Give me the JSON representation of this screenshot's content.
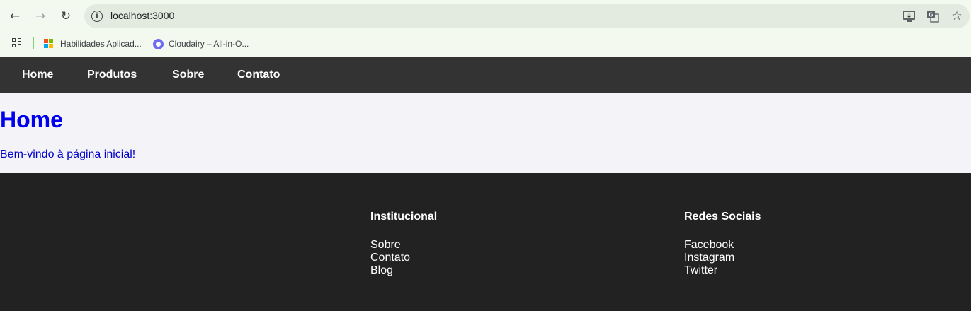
{
  "browser": {
    "url": "localhost:3000",
    "bookmarks": [
      {
        "label": "Habilidades Aplicad...",
        "icon": "microsoft-logo-icon"
      },
      {
        "label": "Cloudairy – All-in-O...",
        "icon": "cloudairy-logo-icon"
      }
    ]
  },
  "site": {
    "nav": {
      "items": [
        "Home",
        "Produtos",
        "Sobre",
        "Contato"
      ]
    },
    "main": {
      "title": "Home",
      "text": "Bem-vindo à página inicial!"
    },
    "footer": {
      "columns": [
        {
          "heading": "Institucional",
          "links": [
            "Sobre",
            "Contato",
            "Blog"
          ]
        },
        {
          "heading": "Redes Sociais",
          "links": [
            "Facebook",
            "Instagram",
            "Twitter"
          ]
        }
      ]
    }
  },
  "colors": {
    "nav_bg": "#333333",
    "footer_bg": "#222222",
    "heading": "#0000ee",
    "body_text": "#0000cd"
  }
}
